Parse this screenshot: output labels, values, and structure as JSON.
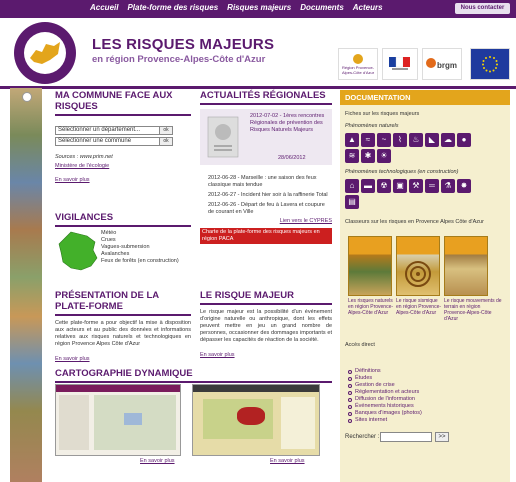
{
  "nav": {
    "items": [
      "Accueil",
      "Plate-forme des risques",
      "Risques majeurs",
      "Documents",
      "Acteurs"
    ],
    "contact": "Nous contacter"
  },
  "header": {
    "title": "LES RISQUES MAJEURS",
    "subtitle": "en région Provence-Alpes-Côte d'Azur",
    "partners": [
      "Région Provence-Alpes-Côte d'Azur",
      "",
      "brgm",
      ""
    ]
  },
  "commune": {
    "title": "MA COMMUNE FACE AUX RISQUES",
    "select_departement": "Sélectionner un département...",
    "select_commune": "Sélectionner une commune",
    "sources": "Sources : www.prim.net",
    "ministere": "Ministère de l'écologie",
    "more": "En savoir plus"
  },
  "actualites": {
    "title": "ACTUALITÉS RÉGIONALES",
    "featured_text": "2012-07-02 - 1ères rencontres Régionales de prévention des Risques Naturels Majeurs",
    "featured_date": "28/06/2012",
    "items": [
      "2012-06-28 - Marseille : une saison des feux classique mais tendue",
      "2012-06-27 - Incident hier soir à la raffinerie Total",
      "2012-06-26 - Départ de feu à Lavera et coupure de courant en Ville"
    ],
    "all_link": "Lien vers le CYPRES",
    "charte": "Charte de la plate-forme des risques majeurs en région PACA"
  },
  "vigilances": {
    "title": "VIGILANCES",
    "items": [
      "Météo",
      "Crues",
      "Vagues-submersion",
      "Avalanches",
      "Feux de forêts (en construction)"
    ]
  },
  "presentation": {
    "title": "PRÉSENTATION DE LA PLATE-FORME",
    "text": "Cette plate-forme a pour objectif la mise à disposition aux acteurs et au public des données et informations relatives aux risques naturels et technologiques en région Provence Alpes Côte d'Azur",
    "more": "En savoir plus"
  },
  "risque": {
    "title": "LE RISQUE MAJEUR",
    "text": "Le risque majeur est la possibilité d'un événement d'origine naturelle ou anthropique, dont les effets peuvent mettre en jeu un grand nombre de personnes, occasionner des dommages importants et dépasser les capacités de réaction de la société.",
    "more": "En savoir plus"
  },
  "carto": {
    "title": "CARTOGRAPHIE DYNAMIQUE",
    "more1": "En savoir plus",
    "more2": "En savoir plus"
  },
  "documentation": {
    "title": "DOCUMENTATION",
    "fiches": "Fiches sur les risques majeurs",
    "naturels": "Phénomènes naturels",
    "techno": "Phénomènes technologiques (en construction)",
    "classeurs": "Classeurs sur les risques en Provence Alpes Côte d'Azur",
    "books": [
      "Les risques naturels en région Provence-Alpes-Côte d'Azur",
      "Le risque sismique en région Provence-Alpes-Côte d'Azur",
      "Le risque mouvements de terrain en région Provence-Alpes-Côte d'Azur"
    ],
    "acces_title": "Accès direct",
    "acces": [
      "Définitions",
      "Études",
      "Gestion de crise",
      "Réglementation et acteurs",
      "Diffusion de l'information",
      "Événements historiques",
      "Banques d'images (photos)",
      "Sites internet"
    ],
    "search_label": "Rechercher :",
    "search_btn": ">>"
  }
}
